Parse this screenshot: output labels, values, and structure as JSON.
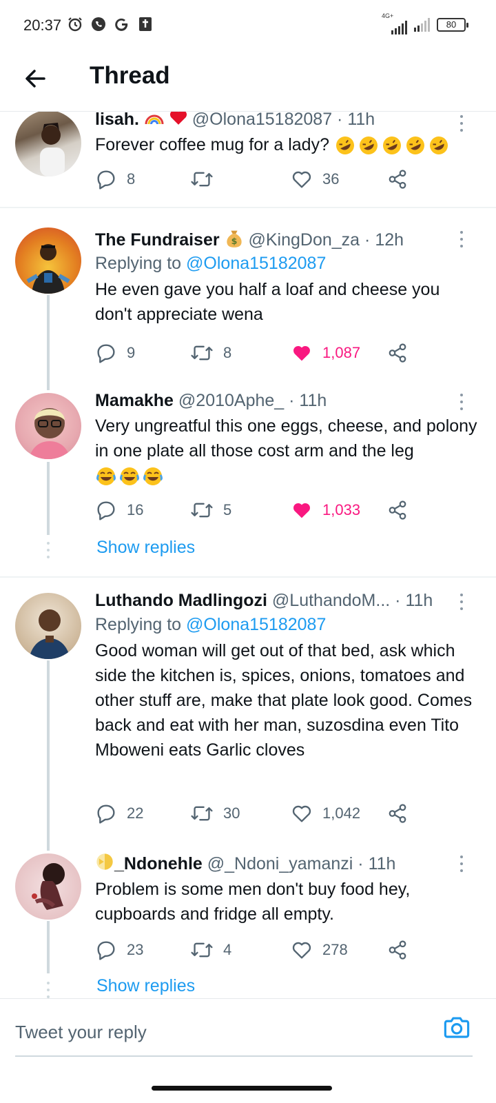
{
  "status_bar": {
    "time": "20:37",
    "network": "4G+",
    "battery": "80"
  },
  "header": {
    "title": "Thread"
  },
  "tweets": [
    {
      "name": "lisah.",
      "handle": "@Olona15182087",
      "age": "11h",
      "body": "Forever coffee mug for a lady?",
      "replies": "8",
      "retweets": "",
      "likes": "36",
      "liked": false
    },
    {
      "name": "The Fundraiser",
      "handle": "@KingDon_za",
      "age": "12h",
      "replying_prefix": "Replying to ",
      "replying_to": "@Olona15182087",
      "body": "He even gave you half a loaf and cheese you don't appreciate wena",
      "replies": "9",
      "retweets": "8",
      "likes": "1,087",
      "liked": true
    },
    {
      "name": "Mamakhe",
      "handle": "@2010Aphe_",
      "age": "11h",
      "body": "Very ungreatful this one eggs, cheese, and polony in one plate all those cost arm and the leg",
      "replies": "16",
      "retweets": "5",
      "likes": "1,033",
      "liked": true,
      "show_replies": "Show replies"
    },
    {
      "name": "Luthando Madlingozi",
      "handle": "@LuthandoM...",
      "age": "11h",
      "replying_prefix": "Replying to ",
      "replying_to": "@Olona15182087",
      "body": "Good woman will get out of that bed, ask which side the kitchen is, spices, onions, tomatoes and other stuff are, make that plate look good. Comes back and eat with her man, suzosdina even Tito Mboweni eats Garlic cloves",
      "replies": "22",
      "retweets": "30",
      "likes": "1,042",
      "liked": false
    },
    {
      "name": "_Ndonehle",
      "handle": "@_Ndoni_yamanzi",
      "age": "11h",
      "body": "Problem is some men don't buy food hey, cupboards and fridge all empty.",
      "replies": "23",
      "retweets": "4",
      "likes": "278",
      "liked": false,
      "show_replies": "Show replies"
    }
  ],
  "reply_bar": {
    "placeholder": "Tweet your reply"
  },
  "colors": {
    "accent": "#1d9bf0",
    "like": "#f91880",
    "muted": "#536471"
  }
}
